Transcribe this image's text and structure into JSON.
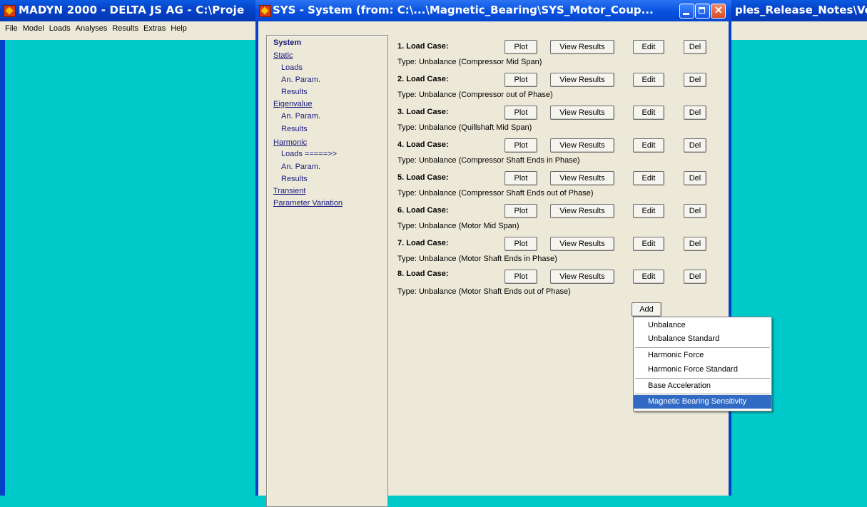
{
  "bg_window": {
    "title": "MADYN 2000 - DELTA JS AG - C:\\Proje",
    "title_right": "ples_Release_Notes\\Ve",
    "menu": [
      "File",
      "Model",
      "Loads",
      "Analyses",
      "Results",
      "Extras",
      "Help"
    ]
  },
  "dialog": {
    "title": "SYS - System (from: C:\\...\\Magnetic_Bearing\\SYS_Motor_Coup...",
    "caption_buttons": [
      "minimize-icon",
      "maximize-icon",
      "close-icon"
    ]
  },
  "nav": {
    "system": "System",
    "static": "Static",
    "static_loads": "Loads",
    "static_anparam": "An. Param.",
    "static_results": "Results",
    "eigenvalue": "Eigenvalue",
    "eig_anparam": "An. Param.",
    "eig_results": "Results",
    "harmonic": "Harmonic",
    "harm_loads": "Loads =====>>",
    "harm_anparam": "An. Param.",
    "harm_results": "Results",
    "transient": "Transient",
    "parameter_variation": "Parameter Variation"
  },
  "buttons": {
    "plot": "Plot",
    "view_results": "View Results",
    "edit": "Edit",
    "del": "Del",
    "add": "Add"
  },
  "load_cases": [
    {
      "label": "1. Load Case:",
      "type": "Type: Unbalance (Compressor Mid Span)"
    },
    {
      "label": "2. Load Case:",
      "type": "Type: Unbalance (Compressor out of Phase)"
    },
    {
      "label": "3. Load Case:",
      "type": "Type: Unbalance (Quillshaft Mid Span)"
    },
    {
      "label": "4. Load Case:",
      "type": "Type: Unbalance (Compressor Shaft Ends in Phase)"
    },
    {
      "label": "5. Load Case:",
      "type": "Type: Unbalance (Compressor Shaft Ends out of Phase)"
    },
    {
      "label": "6. Load Case:",
      "type": "Type: Unbalance (Motor Mid Span)"
    },
    {
      "label": "7. Load Case:",
      "type": "Type: Unbalance (Motor Shaft Ends in Phase)"
    },
    {
      "label": "8. Load Case:",
      "type": "Type: Unbalance (Motor Shaft Ends out of Phase)"
    }
  ],
  "add_menu": {
    "items": [
      "Unbalance",
      "Unbalance Standard",
      "Harmonic Force",
      "Harmonic Force Standard",
      "Base Acceleration",
      "Magnetic Bearing Sensitivity"
    ],
    "selected": "Magnetic Bearing Sensitivity"
  },
  "colors": {
    "desktop": "#00c9c9",
    "titlebar": "#0542c8",
    "dialog_bg": "#ece9d8",
    "menu_highlight": "#316ac5"
  }
}
